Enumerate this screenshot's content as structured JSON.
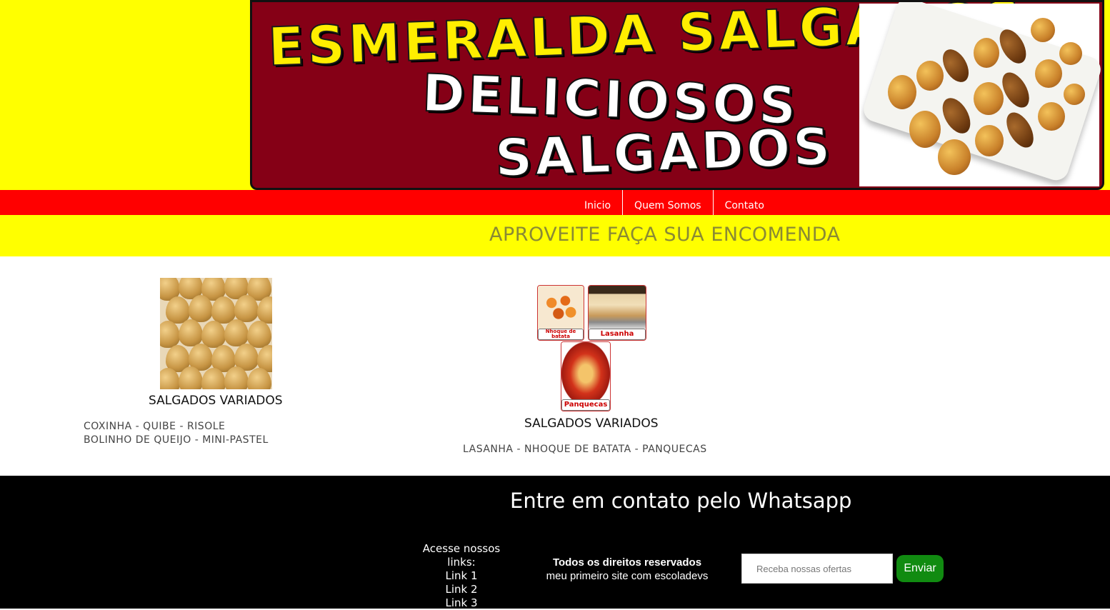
{
  "header": {
    "banner_title": "ESMERALDA SALGADOS",
    "banner_line2": "DELICIOSOS",
    "banner_line3": "SALGADOS"
  },
  "nav": {
    "items": [
      {
        "label": "Inicio"
      },
      {
        "label": "Quem Somos"
      },
      {
        "label": "Contato"
      }
    ]
  },
  "promo": {
    "text": "APROVEITE FAÇA SUA ENCOMENDA"
  },
  "products": [
    {
      "title": "SALGADOS VARIADOS",
      "desc_line1": "COXINHA - QUIBE - RISOLE",
      "desc_line2": "BOLINHO DE QUEIJO - MINI-PASTEL"
    },
    {
      "title": "SALGADOS VARIADOS",
      "desc_line1": "LASANHA - NHOQUE DE BATATA - PANQUECAS",
      "thumbs": [
        {
          "label": "Nhoque de batata"
        },
        {
          "label": "Lasanha"
        },
        {
          "label": "Panquecas"
        }
      ]
    }
  ],
  "footer": {
    "title": "Entre em contato pelo Whatsapp",
    "links_heading": "Acesse nossos links:",
    "links": [
      "Link 1",
      "Link 2",
      "Link 3"
    ],
    "rights_bold": "Todos os direitos reservados",
    "rights_sub": "meu primeiro site com escoladevs",
    "subscribe_placeholder": "Receba nossas ofertas",
    "send_label": "Enviar"
  },
  "colors": {
    "yellow": "#ffff00",
    "red_nav": "#ff0000",
    "banner_maroon": "#850016",
    "footer_black": "#000000",
    "send_green": "#118b11"
  }
}
